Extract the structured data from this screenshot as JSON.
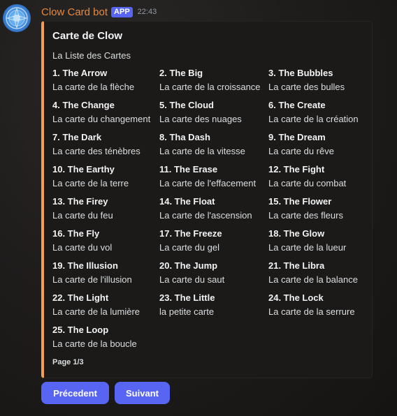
{
  "message": {
    "author": "Clow Card bot",
    "badge": "APP",
    "time": "22:43"
  },
  "embed": {
    "title": "Carte de Clow",
    "description": "La Liste des Cartes",
    "footer": "Page 1/3",
    "accent_color": "#f0a050",
    "cards": [
      {
        "name": "1. The Arrow",
        "desc": "La carte de la flèche"
      },
      {
        "name": "2. The Big",
        "desc": "La carte de la croissance"
      },
      {
        "name": "3. The Bubbles",
        "desc": "La carte des bulles"
      },
      {
        "name": "4. The Change",
        "desc": "La carte du changement"
      },
      {
        "name": "5. The Cloud",
        "desc": "La carte des nuages"
      },
      {
        "name": "6. The Create",
        "desc": "La carte de la création"
      },
      {
        "name": "7. The Dark",
        "desc": "La carte des ténèbres"
      },
      {
        "name": "8. Tha Dash",
        "desc": "La carte de la vitesse"
      },
      {
        "name": "9. The Dream",
        "desc": "La carte du rêve"
      },
      {
        "name": "10. The Earthy",
        "desc": "La carte de la terre"
      },
      {
        "name": "11. The Erase",
        "desc": "La carte de l'effacement"
      },
      {
        "name": "12. The Fight",
        "desc": "La carte du combat"
      },
      {
        "name": "13. The Firey",
        "desc": "La carte du feu"
      },
      {
        "name": "14. The Float",
        "desc": "La carte de l'ascension"
      },
      {
        "name": "15. The Flower",
        "desc": "La carte des fleurs"
      },
      {
        "name": "16. The Fly",
        "desc": "La carte du vol"
      },
      {
        "name": "17. The Freeze",
        "desc": "La carte du gel"
      },
      {
        "name": "18. The Glow",
        "desc": "La carte de la lueur"
      },
      {
        "name": "19. The Illusion",
        "desc": "La carte de l'illusion"
      },
      {
        "name": "20. The Jump",
        "desc": "La carte du saut"
      },
      {
        "name": "21. The Libra",
        "desc": "La carte de la balance"
      },
      {
        "name": "22. The Light",
        "desc": "La carte de la lumière"
      },
      {
        "name": "23. The Little",
        "desc": "la petite carte"
      },
      {
        "name": "24. The Lock",
        "desc": "La carte de la serrure"
      },
      {
        "name": "25. The Loop",
        "desc": "La carte de la boucle"
      }
    ]
  },
  "buttons": {
    "previous": "Précedent",
    "next": "Suivant",
    "color": "#5865f2"
  },
  "avatar_icon": "clow-magic-circle-icon"
}
